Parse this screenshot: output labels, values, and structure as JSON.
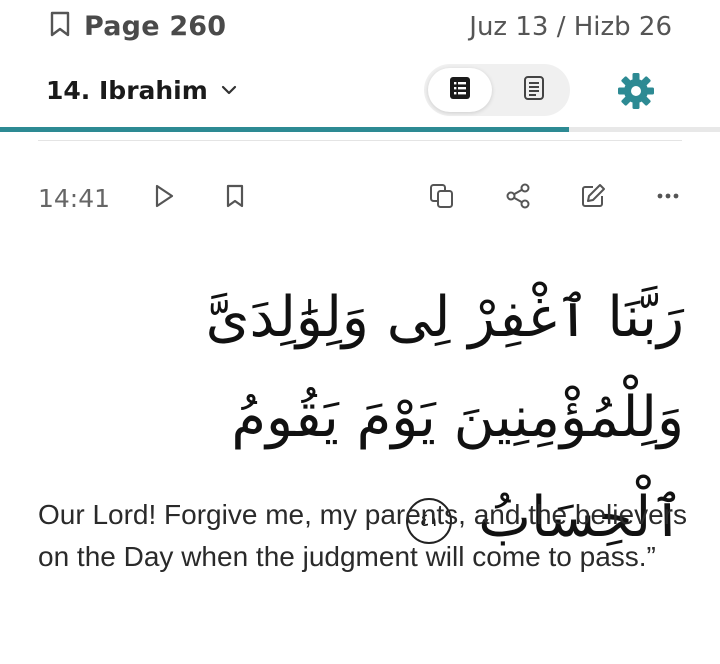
{
  "header": {
    "page_label": "Page 260",
    "juz_hizb": "Juz 13 / Hizb 26"
  },
  "surah": {
    "name": "14. Ibrahim"
  },
  "view_toggle": {
    "active": "verse-by-verse",
    "inactive": "reading"
  },
  "progress": {
    "fraction": 0.79
  },
  "verse": {
    "key": "14:41",
    "arabic": "رَبَّنَا ٱغْفِرْ لِى وَلِوَٰلِدَىَّ وَلِلْمُؤْمِنِينَ يَوْمَ يَقُومُ ٱلْحِسَابُ",
    "ayah_number": "٤١",
    "translation": "Our Lord! Forgive me, my parents, and the believers on the Day when the judgment will come to pass.”"
  },
  "colors": {
    "accent": "#2d8a93"
  },
  "icons": {
    "bookmark": "bookmark-icon",
    "chevron": "chevron-down-icon",
    "settings": "gear-icon",
    "play": "play-icon",
    "copy": "copy-icon",
    "share": "share-icon",
    "note": "edit-note-icon",
    "more": "more-icon"
  }
}
